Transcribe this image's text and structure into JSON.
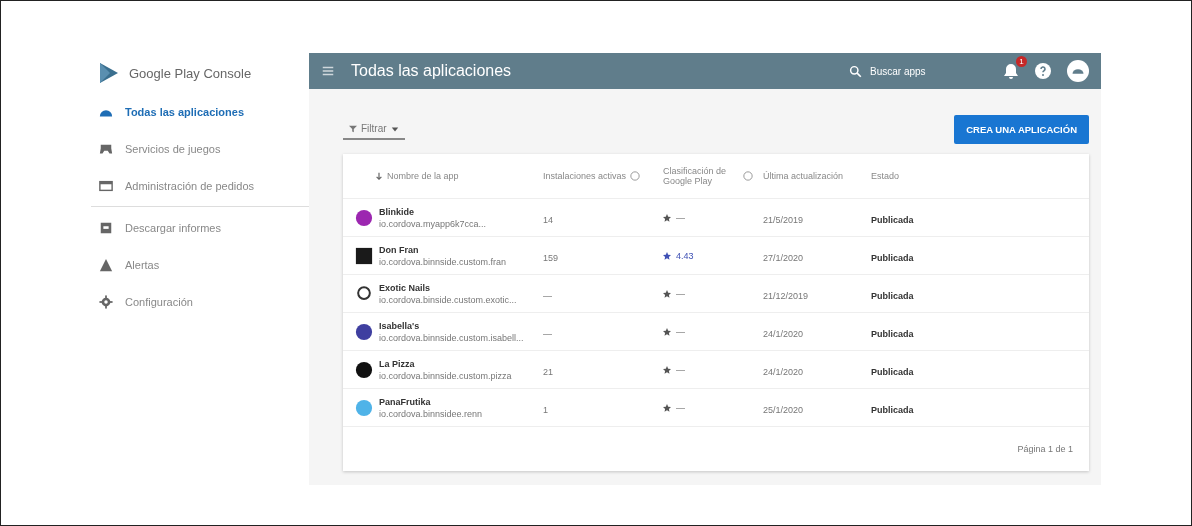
{
  "sidebar": {
    "logo": "Google Play Console",
    "items": [
      {
        "label": "Todas las aplicaciones",
        "selected": true,
        "kind": "android"
      },
      {
        "label": "Servicios de juegos",
        "selected": false,
        "kind": "gamepad"
      },
      {
        "label": "Administración de pedidos",
        "selected": false,
        "kind": "card"
      },
      {
        "label": "Descargar informes",
        "selected": false,
        "kind": "download"
      },
      {
        "label": "Alertas",
        "selected": false,
        "kind": "alert"
      },
      {
        "label": "Configuración",
        "selected": false,
        "kind": "gear"
      }
    ]
  },
  "header": {
    "title": "Todas las aplicaciones",
    "search": {
      "placeholder": "Buscar apps"
    },
    "notification_count": "1"
  },
  "toolbar": {
    "filter": "Filtrar",
    "create_button": "CREA UNA APLICACIÓN"
  },
  "table": {
    "columns": [
      "Nombre de la app",
      "Instalaciones activas",
      "Clasificación de Google Play",
      "Última actualización",
      "Estado"
    ],
    "rows": [
      {
        "name": "Blinkide",
        "package": "io.cordova.myapp6k7cca...",
        "installs": "14",
        "rated": false,
        "rating": "—",
        "updated": "21/5/2019",
        "status": "Publicada",
        "color": "#9c27b0",
        "kind": "circle"
      },
      {
        "name": "Don Fran",
        "package": "io.cordova.binnside.custom.fran",
        "installs": "159",
        "rated": true,
        "rating": "4.43",
        "updated": "27/1/2020",
        "status": "Publicada",
        "color": "#1a1a1a",
        "kind": "square"
      },
      {
        "name": "Exotic Nails",
        "package": "io.cordova.binside.custom.exotic...",
        "installs": "—",
        "rated": false,
        "rating": "—",
        "updated": "21/12/2019",
        "status": "Publicada",
        "color": "#333333",
        "kind": "ring"
      },
      {
        "name": "Isabella's",
        "package": "io.cordova.binnside.custom.isabell...",
        "installs": "—",
        "rated": false,
        "rating": "—",
        "updated": "24/1/2020",
        "status": "Publicada",
        "color": "#3f3fa0",
        "kind": "circle"
      },
      {
        "name": "La Pizza",
        "package": "io.cordova.binnside.custom.pizza",
        "installs": "21",
        "rated": false,
        "rating": "—",
        "updated": "24/1/2020",
        "status": "Publicada",
        "color": "#111111",
        "kind": "circle"
      },
      {
        "name": "PanaFrutika",
        "package": "io.cordova.binnsidee.renn",
        "installs": "1",
        "rated": false,
        "rating": "—",
        "updated": "25/1/2020",
        "status": "Publicada",
        "color": "#4fb3e8",
        "kind": "circle"
      }
    ],
    "pagination": "Página 1 de 1"
  }
}
